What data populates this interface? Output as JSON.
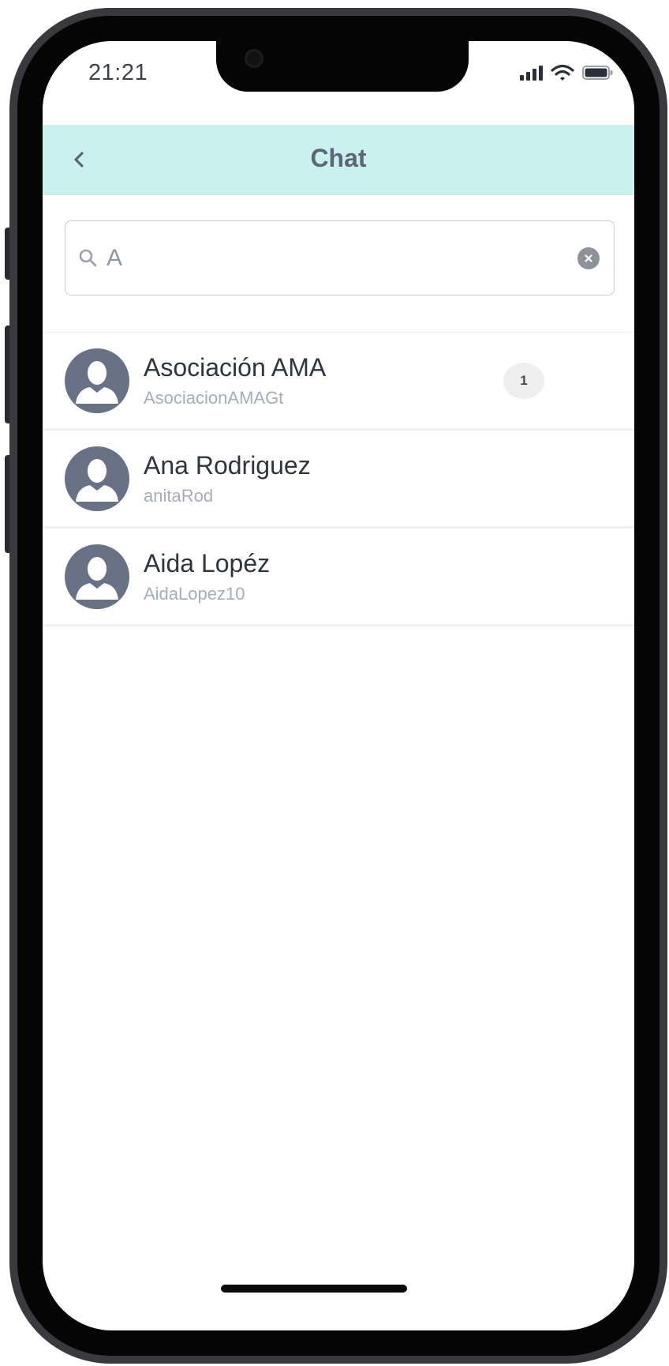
{
  "status_bar": {
    "time": "21:21",
    "signal_icon": "cellular-signal-icon",
    "wifi_icon": "wifi-icon",
    "battery_icon": "battery-icon"
  },
  "header": {
    "title": "Chat",
    "back_icon": "chevron-left-icon",
    "background_color": "#c9f2ee"
  },
  "search": {
    "value": "A",
    "search_icon": "search-icon",
    "clear_icon": "clear-circle-icon"
  },
  "chats": [
    {
      "name": "Asociación AMA",
      "username": "AsociacionAMAGt",
      "unread": "1"
    },
    {
      "name": "Ana Rodriguez",
      "username": "anitaRod",
      "unread": ""
    },
    {
      "name": "Aida Lopéz",
      "username": "AidaLopez10",
      "unread": ""
    }
  ],
  "colors": {
    "avatar": "#697186",
    "title_text": "#5e6577",
    "badge_bg": "#efefef"
  }
}
